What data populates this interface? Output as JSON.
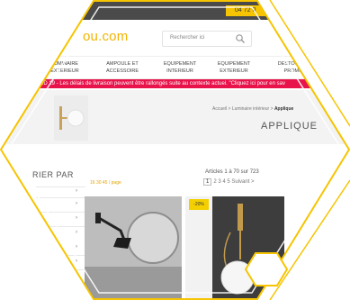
{
  "header": {
    "phone": "04 72 0",
    "logo": "ou.com",
    "search_placeholder": "Rechercher ici",
    "brands_line1": "TOUT",
    "brands_line2": "NOS MARQ"
  },
  "nav": {
    "items": [
      {
        "line1": "LUMINAIRE",
        "line2": "EXTERIEUR"
      },
      {
        "line1": "AMPOULE ET",
        "line2": "ACCESSOIRE"
      },
      {
        "line1": "EQUIPEMENT",
        "line2": "INTERIEUR"
      },
      {
        "line1": "EQUIPEMENT",
        "line2": "EXTERIEUR"
      },
      {
        "line1": "DESTOCKAG",
        "line2": "PROMO"
      }
    ]
  },
  "banner": {
    "text": "OID 19 - Les délais de livraison peuvent être rallongés suite au contexte actuel. \"Cliquez ici pour en sav"
  },
  "hero": {
    "breadcrumb_path": "Accueil > Luminaire intérieur > ",
    "breadcrumb_current": "Applique",
    "title": "APPLIQUE"
  },
  "sidebar": {
    "heading": "RIER PAR",
    "side_text": "E"
  },
  "listing": {
    "count_label": "Articles 1 à 70 sur 723",
    "sort_label": "16 30 45 / page",
    "page_current": "1",
    "page_rest": "2 3 4 5 Suivant >",
    "promo_badge": "-20%"
  },
  "colors": {
    "accent": "#f2b400",
    "banner": "#e8134b",
    "topbar": "#4a4a4a",
    "hex_border": "#f6c400"
  }
}
